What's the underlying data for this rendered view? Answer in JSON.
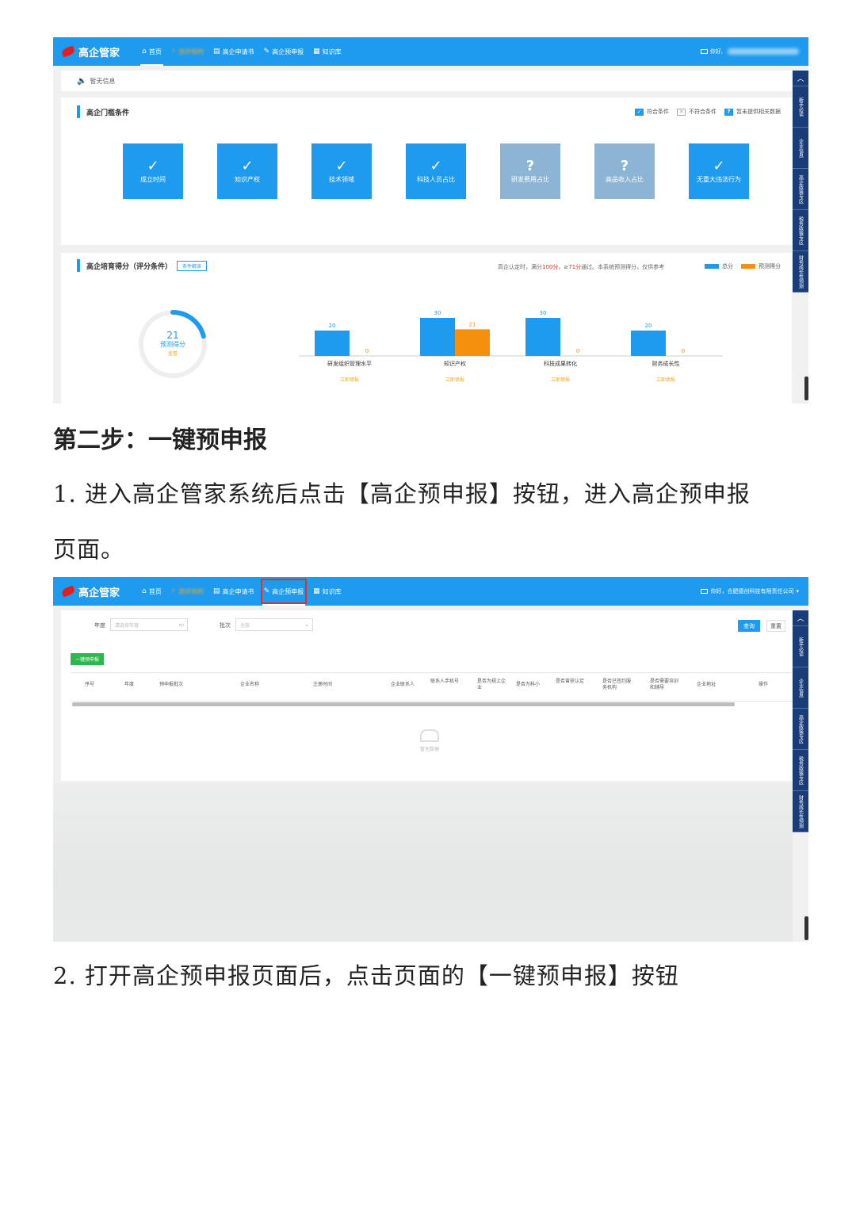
{
  "shot1": {
    "logo": "高企管家",
    "nav": [
      {
        "icon": "⌂",
        "label": "首页"
      },
      {
        "icon": "⚡",
        "label": "测评预判"
      },
      {
        "icon": "▤",
        "label": "高企申请书"
      },
      {
        "icon": "✎",
        "label": "高企预申报"
      },
      {
        "icon": "▦",
        "label": "知识库"
      }
    ],
    "top_right": "你好,",
    "notice": "暂无信息",
    "threshold": {
      "title": "高企门槛条件",
      "legend": [
        {
          "label": "符合条件",
          "color": "#1e9bef"
        },
        {
          "label": "不符合条件",
          "color": "#bbbbbb"
        },
        {
          "label": "暂未提供相关数据",
          "color": "#1e9bef"
        }
      ],
      "tiles": [
        {
          "icon": "✓",
          "label": "成立时间",
          "status": "pass"
        },
        {
          "icon": "✓",
          "label": "知识产权",
          "status": "pass"
        },
        {
          "icon": "✓",
          "label": "技术领域",
          "status": "pass"
        },
        {
          "icon": "✓",
          "label": "科技人员占比",
          "status": "pass"
        },
        {
          "icon": "?",
          "label": "研发费用占比",
          "status": "unknown"
        },
        {
          "icon": "?",
          "label": "高品收入占比",
          "status": "unknown"
        },
        {
          "icon": "✓",
          "label": "无重大违法行为",
          "status": "pass"
        }
      ]
    },
    "score": {
      "title": "高企培育得分（评分条件）",
      "button": "条件解读",
      "note_pre": "高企认定时，满分",
      "note_hl1": "100分",
      "note_mid": "，≥",
      "note_hl2": "71分",
      "note_post": "通过。本系统预测得分，仅供参考",
      "legend_total": "总分",
      "legend_pred": "预测得分",
      "ring_value": "21",
      "ring_label": "预测得分",
      "ring_sub": "查看",
      "ring_fraction": 0.21
    },
    "chart_data": {
      "type": "bar",
      "categories": [
        "研发组织管理水平",
        "知识产权",
        "科技成果转化",
        "财务成长性"
      ],
      "series": [
        {
          "name": "总分",
          "values": [
            20,
            30,
            30,
            20
          ],
          "color": "#1e9bef"
        },
        {
          "name": "预测得分",
          "values": [
            0,
            21,
            0,
            0
          ],
          "color": "#f5900f"
        }
      ],
      "ylim": [
        0,
        30
      ],
      "links": [
        "立即填报",
        "立即填报",
        "立即填报",
        "立即填报"
      ]
    },
    "sidebar": [
      "新手必读",
      "企业信息",
      "高企政策专区",
      "税务政策专区",
      "财务成长性预测"
    ]
  },
  "text": {
    "step_head": "第二步：一键预申报",
    "para1": "1. 进入高企管家系统后点击【高企预申报】按钮，进入高企预申报",
    "para1b": "页面。",
    "para2": "2. 打开高企预申报页面后，点击页面的【一键预申报】按钮"
  },
  "shot2": {
    "logo": "高企管家",
    "nav": [
      {
        "icon": "⌂",
        "label": "首页"
      },
      {
        "icon": "⚡",
        "label": "测评预判"
      },
      {
        "icon": "▤",
        "label": "高企申请书"
      },
      {
        "icon": "✎",
        "label": "高企预申报"
      },
      {
        "icon": "▦",
        "label": "知识库"
      }
    ],
    "top_right": "你好，合肥德创科技有限责任公司",
    "filters": {
      "year_label": "年度",
      "year_placeholder": "请选择年度",
      "batch_label": "批次",
      "batch_placeholder": "全部",
      "query": "查询",
      "reset": "重置"
    },
    "one_click": "一键预申报",
    "columns": [
      "序号",
      "年度",
      "预申报批次",
      "企业名称",
      "注册时间",
      "企业联系人",
      "联系人手机号",
      "是否为规上企业",
      "是否为科小",
      "是否曾获认定",
      "是否已签约服务机构",
      "是否需要培训和辅导",
      "企业地址",
      "操作"
    ],
    "empty": "暂无数据",
    "sidebar": [
      "新手必读",
      "企业信息",
      "高企政策专区",
      "税务政策专区",
      "财务成长性预测"
    ]
  }
}
